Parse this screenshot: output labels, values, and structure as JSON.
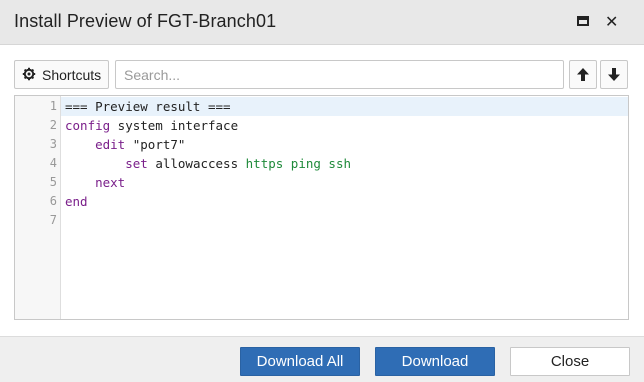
{
  "dialog": {
    "title": "Install Preview of FGT-Branch01",
    "maximize_icon": "maximize-icon",
    "close_icon": "close-icon"
  },
  "toolbar": {
    "shortcuts_label": "Shortcuts",
    "shortcuts_icon": "settings-icon",
    "search_placeholder": "Search...",
    "search_value": "",
    "up_icon": "arrow-up-icon",
    "down_icon": "arrow-down-icon"
  },
  "editor": {
    "lines": [
      {
        "num": "1",
        "parts": [
          {
            "text": "=== Preview result ===",
            "cls": ""
          }
        ]
      },
      {
        "num": "2",
        "parts": [
          {
            "text": "config",
            "cls": "kw"
          },
          {
            "text": " system interface",
            "cls": ""
          }
        ]
      },
      {
        "num": "3",
        "parts": [
          {
            "text": "    ",
            "cls": ""
          },
          {
            "text": "edit",
            "cls": "kw"
          },
          {
            "text": " \"port7\"",
            "cls": "str"
          }
        ]
      },
      {
        "num": "4",
        "parts": [
          {
            "text": "        ",
            "cls": ""
          },
          {
            "text": "set",
            "cls": "kw"
          },
          {
            "text": " allowaccess ",
            "cls": ""
          },
          {
            "text": "https ping ssh",
            "cls": "val"
          }
        ]
      },
      {
        "num": "5",
        "parts": [
          {
            "text": "    ",
            "cls": ""
          },
          {
            "text": "next",
            "cls": "kw"
          }
        ]
      },
      {
        "num": "6",
        "parts": [
          {
            "text": "end",
            "cls": "kw"
          }
        ]
      },
      {
        "num": "7",
        "parts": []
      }
    ]
  },
  "footer": {
    "download_all_label": "Download All",
    "download_label": "Download",
    "close_label": "Close"
  },
  "colors": {
    "primary": "#2f6db5",
    "keyword": "#7a1f8a",
    "value": "#1f8a3a",
    "active_line": "#e8f2fb"
  }
}
